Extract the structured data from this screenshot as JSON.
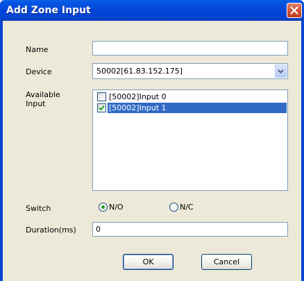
{
  "window": {
    "title": "Add Zone Input",
    "title_color": "#ffffff",
    "titlebar_color": "#0346d6"
  },
  "form": {
    "name_label": "Name",
    "name_value": "",
    "device_label": "Device",
    "device_selected": "50002[61.83.152.175]",
    "available_input_label_line1": "Available",
    "available_input_label_line2": "Input",
    "inputs": [
      {
        "label": "[50002]Input 0",
        "checked": false,
        "selected": false
      },
      {
        "label": "[50002]Input 1",
        "checked": true,
        "selected": true
      }
    ],
    "switch_label": "Switch",
    "switch_options": [
      {
        "label": "N/O",
        "selected": true
      },
      {
        "label": "N/C",
        "selected": false
      }
    ],
    "duration_label": "Duration(ms)",
    "duration_value": "0"
  },
  "buttons": {
    "ok_label": "OK",
    "cancel_label": "Cancel"
  },
  "icons": {
    "close": "close-icon",
    "dropdown": "chevron-down-icon",
    "check": "check-icon"
  },
  "colors": {
    "selection": "#316ac5",
    "dialog_bg": "#ece9d8",
    "radio_dot": "#21a121"
  }
}
